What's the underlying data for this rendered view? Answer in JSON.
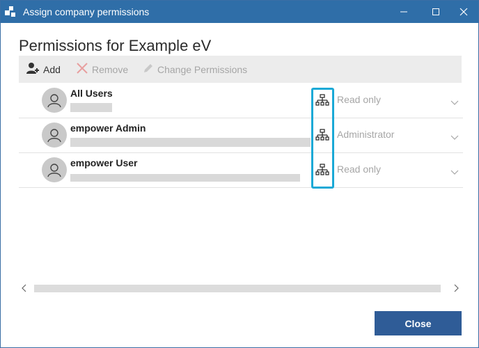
{
  "window": {
    "title": "Assign company permissions",
    "accent": "#2f6ea8"
  },
  "heading": "Permissions for Example eV",
  "toolbar": {
    "add_label": "Add",
    "remove_label": "Remove",
    "change_label": "Change Permissions"
  },
  "rows": [
    {
      "name": "All Users",
      "permission": "Read only",
      "icon": "hierarchy-icon"
    },
    {
      "name": "empower Admin",
      "permission": "Administrator",
      "icon": "hierarchy-icon"
    },
    {
      "name": "empower User",
      "permission": "Read only",
      "icon": "hierarchy-icon"
    }
  ],
  "footer": {
    "close_label": "Close",
    "close_color": "#2f5c97"
  },
  "highlight_color": "#1aa9d6"
}
